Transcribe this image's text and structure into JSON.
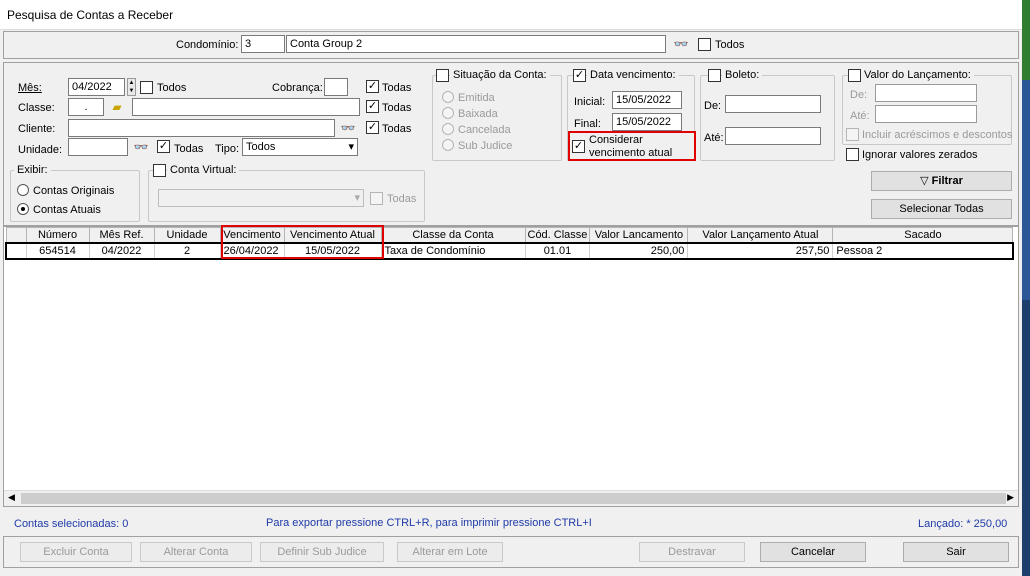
{
  "window": {
    "title": "Pesquisa de Contas a Receber"
  },
  "condominio": {
    "label": "Condomínio:",
    "code": "3",
    "name": "Conta Group 2",
    "todos_label": "Todos"
  },
  "filters": {
    "mes_label": "Mês:",
    "mes_value": "04/2022",
    "mes_todos": "Todos",
    "cobranca_label": "Cobrança:",
    "cobranca_todas": "Todas",
    "classe_label": "Classe:",
    "classe_value": ".",
    "classe_todas": "Todas",
    "cliente_label": "Cliente:",
    "cliente_todas": "Todas",
    "unidade_label": "Unidade:",
    "unidade_todas": "Todas",
    "tipo_label": "Tipo:",
    "tipo_value": "Todos"
  },
  "exibir": {
    "title": "Exibir:",
    "originais": "Contas Originais",
    "atuais": "Contas Atuais"
  },
  "conta_virtual": {
    "title": "Conta Virtual:",
    "todas": "Todas"
  },
  "situacao": {
    "title": "Situação da Conta:",
    "options": [
      "Emitida",
      "Baixada",
      "Cancelada",
      "Sub Judice"
    ]
  },
  "data_venc": {
    "title": "Data vencimento:",
    "inicial_label": "Inicial:",
    "inicial": "15/05/2022",
    "final_label": "Final:",
    "final": "15/05/2022",
    "considerar_1": "Considerar",
    "considerar_2": "vencimento atual"
  },
  "boleto": {
    "title": "Boleto:",
    "de_label": "De:",
    "ate_label": "Até:"
  },
  "valor_lanc": {
    "title": "Valor do Lançamento:",
    "de_label": "De:",
    "ate_label": "Até:",
    "incluir": "Incluir acréscimos e descontos",
    "ignorar": "Ignorar valores zerados"
  },
  "actions": {
    "filtrar": "Filtrar",
    "selecionar_todas": "Selecionar Todas"
  },
  "grid": {
    "columns": [
      "Número",
      "Mês Ref.",
      "Unidade",
      "Vencimento",
      "Vencimento Atual",
      "Classe da Conta",
      "Cód. Classe",
      "Valor Lancamento",
      "Valor Lançamento Atual",
      "Sacado"
    ],
    "rows": [
      [
        "654514",
        "04/2022",
        "2",
        "26/04/2022",
        "15/05/2022",
        "Taxa de Condomínio",
        "01.01",
        "250,00",
        "257,50",
        "Pessoa 2"
      ]
    ]
  },
  "status": {
    "selecionadas": "Contas selecionadas: 0",
    "hint": "Para exportar pressione CTRL+R,  para imprimir pressione CTRL+I",
    "lancado": "Lançado: * 250,00"
  },
  "footer_buttons": {
    "excluir": "Excluir Conta",
    "alterar": "Alterar Conta",
    "sub_judice": "Definir Sub Judice",
    "lote": "Alterar em Lote",
    "destravar": "Destravar",
    "cancelar": "Cancelar",
    "sair": "Sair"
  },
  "colors": {
    "highlight": "#e00000",
    "link": "#1f3aa8"
  }
}
